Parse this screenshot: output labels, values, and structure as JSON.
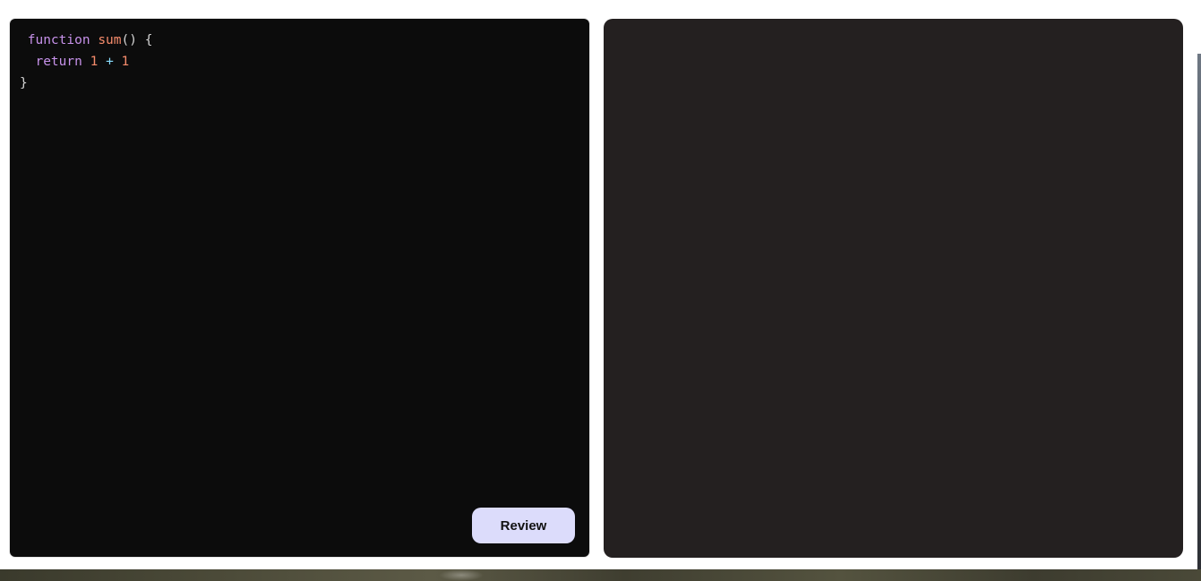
{
  "editor": {
    "tokens": {
      "function_kw": "function",
      "fn_name": "sum",
      "parens_open": "() {",
      "return_kw": "return",
      "num_a": "1",
      "plus": "+",
      "num_b": "1",
      "close_brace": "}"
    },
    "review_label": "Review"
  },
  "output": {
    "text": ""
  },
  "colors": {
    "editor_bg": "#0c0c0c",
    "output_bg": "#242020",
    "button_bg": "#dcdcfb",
    "keyword": "#c792ea",
    "number": "#f78c6c",
    "operator": "#89ddff"
  }
}
